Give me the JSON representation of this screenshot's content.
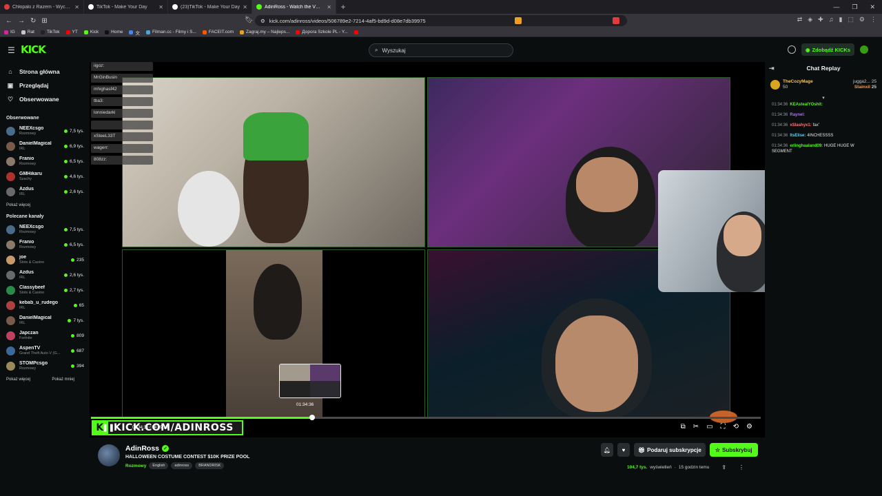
{
  "browser": {
    "tabs": [
      {
        "title": "Chłopaki z Razem - Wyczkarz bawi s",
        "color": "#e03c3c"
      },
      {
        "title": "TikTok - Make Your Day",
        "color": "#ffffff"
      },
      {
        "title": "(23)TikTok - Make Your Day",
        "color": "#ffffff"
      },
      {
        "title": "AdinRoss - Watch the VOD o",
        "color": "#53fc18",
        "active": true
      }
    ],
    "new_tab": "+",
    "url": "kick.com/adinross/videos/506789e2-7214-4af5-bd9d-d08e7db39975",
    "bookmarks": [
      {
        "label": "IG",
        "color": "#d6249f"
      },
      {
        "label": "Rat",
        "color": "#c8c8c8"
      },
      {
        "label": "TikTok",
        "color": "#222222"
      },
      {
        "label": "YT",
        "color": "#ff0000"
      },
      {
        "label": "Kick",
        "color": "#53fc18"
      },
      {
        "label": "Home",
        "color": "#111111"
      },
      {
        "label": "文",
        "color": "#4285f4"
      },
      {
        "label": "Filman.cc - Filmy i S...",
        "color": "#4aa8d8"
      },
      {
        "label": "FACEIT.com",
        "color": "#ff5500"
      },
      {
        "label": "Zagraj.my – Najleps...",
        "color": "#e8a317"
      },
      {
        "label": "Дорога Szkole PL - Y...",
        "color": "#ff0000"
      },
      {
        "label": "",
        "color": "#ff0000"
      }
    ]
  },
  "header": {
    "logo": "KICK",
    "search_placeholder": "Wyszukaj",
    "get_kicks": "Zdobądź KICKs"
  },
  "sidebar": {
    "nav": [
      {
        "label": "Strona główna",
        "icon": "home-icon",
        "glyph": "⌂"
      },
      {
        "label": "Przeglądaj",
        "icon": "browse-icon",
        "glyph": "▣"
      },
      {
        "label": "Obserwowane",
        "icon": "heart-icon",
        "glyph": "♡"
      }
    ],
    "followed_title": "Obserwowane",
    "followed": [
      {
        "name": "NEEXcsgo",
        "category": "Rozmowy",
        "viewers": "7,5 tys.",
        "color": "#4a6b8a"
      },
      {
        "name": "DanielMagical",
        "category": "IRL",
        "viewers": "6,9 tys.",
        "color": "#7a5a4a"
      },
      {
        "name": "Franio",
        "category": "Rozmowy",
        "viewers": "6,5 tys.",
        "color": "#8a7a6a"
      },
      {
        "name": "GMHikaru",
        "category": "Szachy",
        "viewers": "4,6 tys.",
        "color": "#b03030"
      },
      {
        "name": "Azdus",
        "category": "IRL",
        "viewers": "2,6 tys.",
        "color": "#6a6a6a"
      }
    ],
    "show_more": "Pokaż więcej",
    "recommended_title": "Polecane kanały",
    "recommended": [
      {
        "name": "NEEXcsgo",
        "category": "Rozmowy",
        "viewers": "7,5 tys.",
        "color": "#4a6b8a"
      },
      {
        "name": "Franio",
        "category": "Rozmowy",
        "viewers": "6,5 tys.",
        "color": "#8a7a6a"
      },
      {
        "name": "joe",
        "category": "Slots & Casino",
        "viewers": "235",
        "color": "#c89a6a"
      },
      {
        "name": "Azdus",
        "category": "IRL",
        "viewers": "2,6 tys.",
        "color": "#6a6a6a"
      },
      {
        "name": "Classybeef",
        "category": "Slots & Casino",
        "viewers": "2,7 tys.",
        "color": "#2a8a4a"
      },
      {
        "name": "kebab_u_rudego",
        "category": "IRL",
        "viewers": "65",
        "color": "#b04040"
      },
      {
        "name": "DanielMagical",
        "category": "IRL",
        "viewers": "7 tys.",
        "color": "#7a5a4a"
      },
      {
        "name": "Japczan",
        "category": "Fortnite",
        "viewers": "809",
        "color": "#c04060"
      },
      {
        "name": "AspenTV",
        "category": "Grand Theft Auto V (G...",
        "viewers": "687",
        "color": "#3a6a9a"
      },
      {
        "name": "STOMPcsgo",
        "category": "Rozmowy",
        "viewers": "394",
        "color": "#9a8a5a"
      }
    ],
    "show_more_2": "Pokaż więcej",
    "show_less": "Pokaż mniej"
  },
  "video": {
    "overlay_chat": [
      "iigoz: ",
      "MrGinBusin",
      "mhighasf42",
      "tba3: ",
      "lonniedarki",
      "",
      "xSteeL33T",
      "wagerr: ",
      "808zz: "
    ],
    "preview_time": "01:34:36",
    "watermark": "KICK.COM/ADINROSS",
    "progress_fraction": 0.33,
    "time_display": "01:34:36 / 04:49:13"
  },
  "chat": {
    "title": "Chat Replay",
    "pinned_user": "TheCozyMage",
    "pinned_amount": "50",
    "pinned_rhs": "jugga2...",
    "pinned_rhs2": "Stainxil",
    "pinned_num1": "25",
    "pinned_num2": "25",
    "messages": [
      {
        "time": "01:34:36",
        "user": "KEAsteaIYOshit:",
        "text": "",
        "color": "#53fc18"
      },
      {
        "time": "01:34:36",
        "user": "Raynel:",
        "text": "",
        "color": "#b36bff"
      },
      {
        "time": "01:34:36",
        "user": "xSlashyx1:",
        "text": "fax'",
        "color": "#ff7a7a"
      },
      {
        "time": "01:34:36",
        "user": "ItsElise:",
        "text": "4INCHESSSS",
        "color": "#53d6ff"
      },
      {
        "time": "01:34:36",
        "user": "erlinghaaland09:",
        "text": "HUGE HUGE W SEGMENT",
        "color": "#53fc18"
      }
    ]
  },
  "stream": {
    "name": "AdinRoss",
    "title": "HALLOWEEN COSTUME CONTEST $10K PRIZE POOL",
    "category": "Rozmowy",
    "tags": [
      "English",
      "adinross",
      "BRANDRISK"
    ],
    "gift_label": "Podaruj subskrypcje",
    "subscribe_label": "Subskrybuj",
    "views": "104,7 tys.",
    "views_label": "wyświetleń",
    "ago": "15 godzin temu"
  },
  "colors": {
    "accent": "#53fc18",
    "bg": "#0b0e0f"
  }
}
